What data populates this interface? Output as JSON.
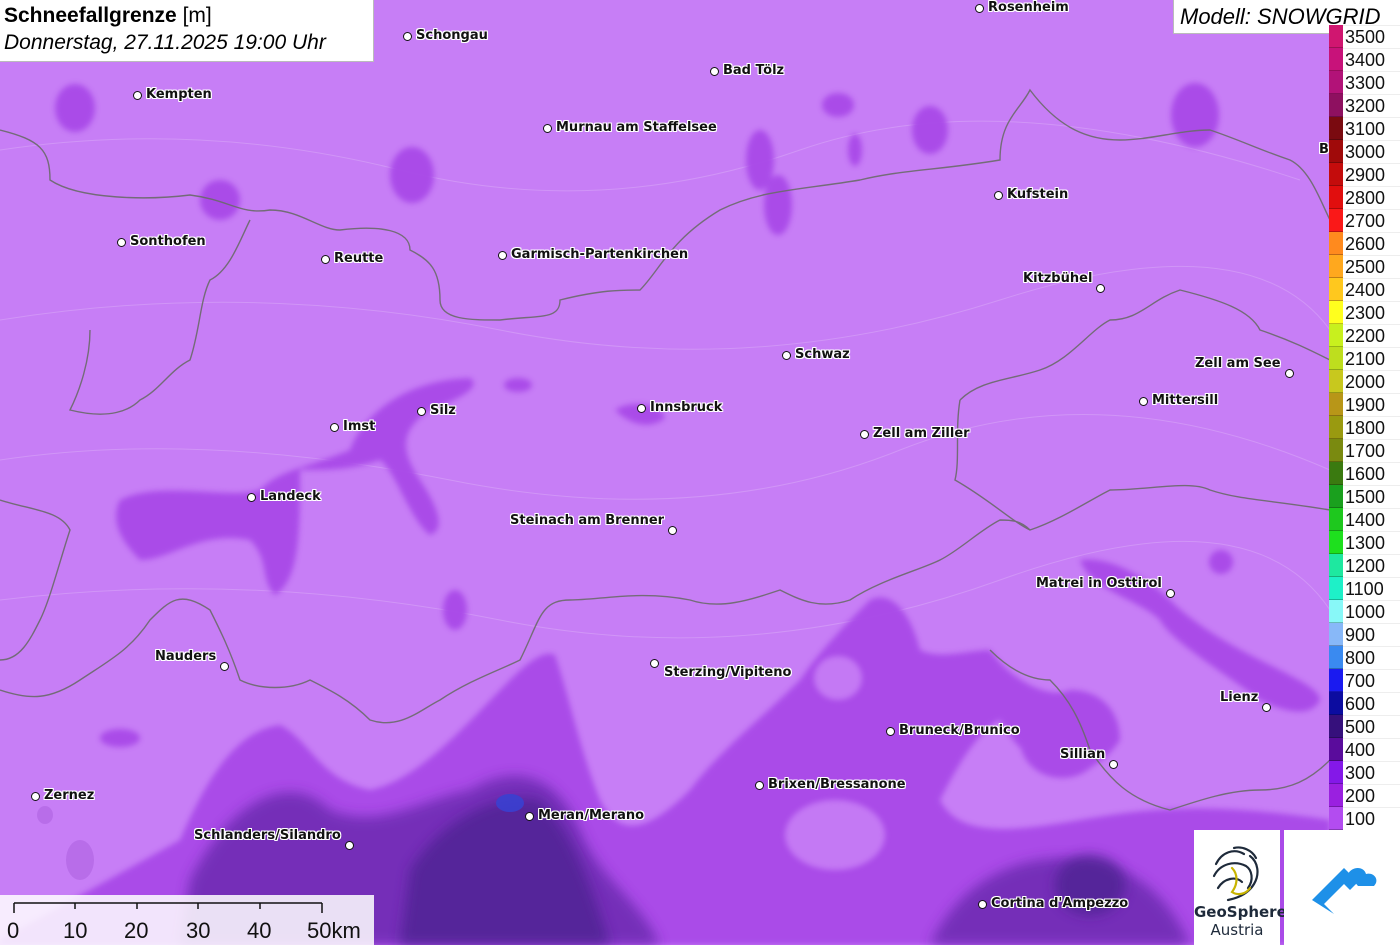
{
  "title": {
    "bold": "Schneefallgrenze",
    "unit": "[m]",
    "date": "Donnerstag, 27.11.2025 19:00 Uhr"
  },
  "model": "Modell: SNOWGRID",
  "legend": {
    "values": [
      "3500",
      "3400",
      "3300",
      "3200",
      "3100",
      "3000",
      "2900",
      "2800",
      "2700",
      "2600",
      "2500",
      "2400",
      "2300",
      "2200",
      "2100",
      "2000",
      "1900",
      "1800",
      "1700",
      "1600",
      "1500",
      "1400",
      "1300",
      "1200",
      "1100",
      "1000",
      "900",
      "800",
      "700",
      "600",
      "500",
      "400",
      "300",
      "200",
      "100"
    ],
    "colors": [
      "#d01670",
      "#c8127a",
      "#b21278",
      "#8e1060",
      "#7a0a10",
      "#a00a0a",
      "#c40c0c",
      "#e10e0e",
      "#fa1818",
      "#ff8a1e",
      "#ffa81e",
      "#ffc81e",
      "#ffff1e",
      "#c8f01e",
      "#bede1e",
      "#c8c81e",
      "#b89618",
      "#9a9a10",
      "#7a8a10",
      "#3a7a10",
      "#1aa01e",
      "#1ec81e",
      "#1ee01e",
      "#1ee8a0",
      "#1ef0c8",
      "#88f8f8",
      "#88b8f8",
      "#3a8af0",
      "#1a1af0",
      "#0c0ca0",
      "#36107c",
      "#5a0c9c",
      "#8418e8",
      "#9a20e0",
      "#b34cf0"
    ]
  },
  "scale": {
    "labels": [
      "0",
      "10",
      "20",
      "30",
      "40",
      "50km"
    ]
  },
  "logos": {
    "geosphere_line1": "GeoSphere",
    "geosphere_line2": "Austria"
  },
  "cities": [
    {
      "name": "Rosenheim",
      "label": "Rosenheim"
    },
    {
      "name": "Schongau",
      "label": "Schongau"
    },
    {
      "name": "Bad Tölz",
      "label": "Bad Tölz"
    },
    {
      "name": "Kempten",
      "label": "Kempten"
    },
    {
      "name": "Murnau am Staffelsee",
      "label": "Murnau am Staffelsee"
    },
    {
      "name": "Berchtesgaden",
      "label": "Berchte"
    },
    {
      "name": "Kufstein",
      "label": "Kufstein"
    },
    {
      "name": "Sonthofen",
      "label": "Sonthofen"
    },
    {
      "name": "Reutte",
      "label": "Reutte"
    },
    {
      "name": "Garmisch-Partenkirchen",
      "label": "Garmisch-Partenkirchen"
    },
    {
      "name": "Kitzbühel",
      "label": "Kitzbühel"
    },
    {
      "name": "Schwaz",
      "label": "Schwaz"
    },
    {
      "name": "Zell am See",
      "label": "Zell am See"
    },
    {
      "name": "Mittersill",
      "label": "Mittersill"
    },
    {
      "name": "Innsbruck",
      "label": "Innsbruck"
    },
    {
      "name": "Silz",
      "label": "Silz"
    },
    {
      "name": "Imst",
      "label": "Imst"
    },
    {
      "name": "Zell am Ziller",
      "label": "Zell am Ziller"
    },
    {
      "name": "Landeck",
      "label": "Landeck"
    },
    {
      "name": "Steinach am Brenner",
      "label": "Steinach am Brenner"
    },
    {
      "name": "Matrei in Osttirol",
      "label": "Matrei in Osttirol"
    },
    {
      "name": "Nauders",
      "label": "Nauders"
    },
    {
      "name": "Sterzing/Vipiteno",
      "label": "Sterzing/Vipiteno"
    },
    {
      "name": "Lienz",
      "label": "Lienz"
    },
    {
      "name": "Bruneck/Brunico",
      "label": "Bruneck/Brunico"
    },
    {
      "name": "Sillian",
      "label": "Sillian"
    },
    {
      "name": "Brixen/Bressanone",
      "label": "Brixen/Bressanone"
    },
    {
      "name": "Zernez",
      "label": "Zernez"
    },
    {
      "name": "Meran/Merano",
      "label": "Meran/Merano"
    },
    {
      "name": "Schlanders/Silandro",
      "label": "Schlanders/Silandro"
    },
    {
      "name": "Cortina d'Ampezzo",
      "label": "Cortina d'Ampezzo"
    }
  ]
}
